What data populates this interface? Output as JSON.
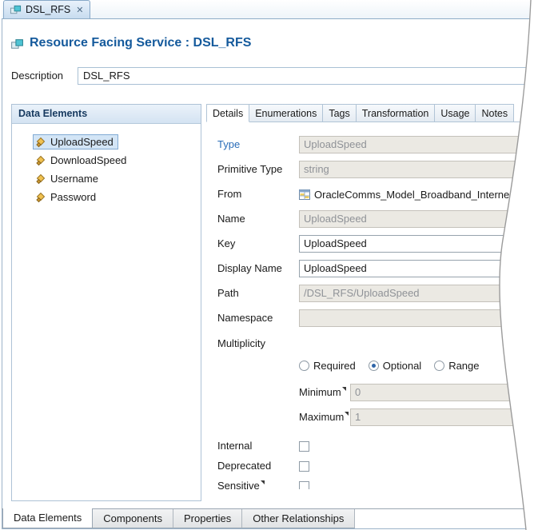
{
  "icons": {
    "close": "✕"
  },
  "editor_tab": {
    "label": "DSL_RFS"
  },
  "header": {
    "title": "Resource Facing Service : DSL_RFS"
  },
  "description": {
    "label": "Description",
    "value": "DSL_RFS"
  },
  "data_elements": {
    "title": "Data Elements",
    "items": [
      {
        "label": "UploadSpeed",
        "selected": true
      },
      {
        "label": "DownloadSpeed",
        "selected": false
      },
      {
        "label": "Username",
        "selected": false
      },
      {
        "label": "Password",
        "selected": false
      }
    ]
  },
  "detail_tabs": {
    "tabs": [
      {
        "label": "Details",
        "active": true
      },
      {
        "label": "Enumerations",
        "active": false
      },
      {
        "label": "Tags",
        "active": false
      },
      {
        "label": "Transformation",
        "active": false
      },
      {
        "label": "Usage",
        "active": false
      },
      {
        "label": "Notes",
        "active": false
      }
    ]
  },
  "form": {
    "type": {
      "label": "Type",
      "value": "UploadSpeed"
    },
    "primitive_type": {
      "label": "Primitive Type",
      "value": "string"
    },
    "from": {
      "label": "From",
      "value": "OracleComms_Model_Broadband_Interne"
    },
    "name": {
      "label": "Name",
      "value": "UploadSpeed"
    },
    "key": {
      "label": "Key",
      "value": "UploadSpeed"
    },
    "display_name": {
      "label": "Display Name",
      "value": "UploadSpeed"
    },
    "path": {
      "label": "Path",
      "value": "/DSL_RFS/UploadSpeed"
    },
    "namespace": {
      "label": "Namespace",
      "value": ""
    },
    "multiplicity": {
      "label": "Multiplicity",
      "options": [
        {
          "label": "Required",
          "selected": false
        },
        {
          "label": "Optional",
          "selected": true
        },
        {
          "label": "Range",
          "selected": false
        }
      ],
      "minimum": {
        "label": "Minimum",
        "value": "0"
      },
      "maximum": {
        "label": "Maximum",
        "value": "1"
      }
    },
    "internal": {
      "label": "Internal",
      "checked": false
    },
    "deprecated": {
      "label": "Deprecated",
      "checked": false
    },
    "sensitive": {
      "label": "Sensitive",
      "checked": false
    }
  },
  "bottom_tabs": {
    "tabs": [
      {
        "label": "Data Elements",
        "active": true
      },
      {
        "label": "Components",
        "active": false
      },
      {
        "label": "Properties",
        "active": false
      },
      {
        "label": "Other Relationships",
        "active": false
      }
    ]
  }
}
